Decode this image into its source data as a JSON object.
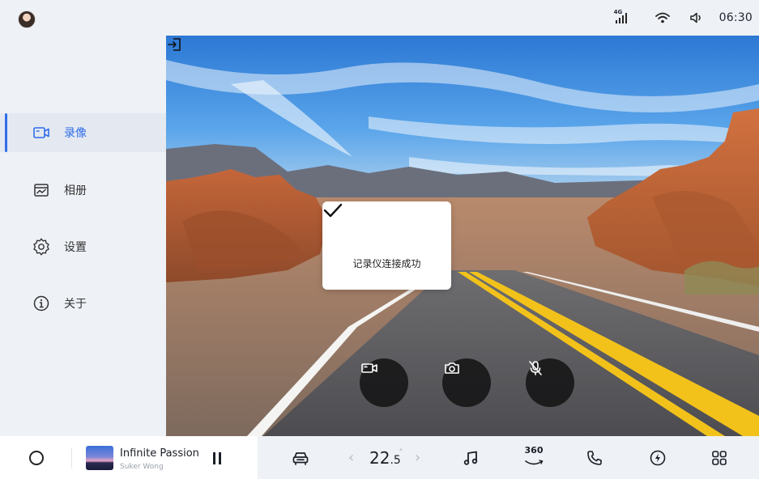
{
  "status_bar": {
    "network_label": "4G",
    "time": "06:30"
  },
  "sidebar": {
    "items": [
      {
        "label": "录像",
        "icon": "video-icon",
        "active": true
      },
      {
        "label": "相册",
        "icon": "album-icon",
        "active": false
      },
      {
        "label": "设置",
        "icon": "gear-icon",
        "active": false
      },
      {
        "label": "关于",
        "icon": "info-icon",
        "active": false
      }
    ]
  },
  "toast": {
    "message": "记录仪连接成功"
  },
  "controls": [
    "record-video-icon",
    "camera-icon",
    "mic-off-icon"
  ],
  "dock": {
    "now_playing": {
      "title": "Infinite Passion",
      "artist": "Suker Wong"
    },
    "temperature": {
      "whole": "22",
      "decimal": ".5",
      "unit": "°"
    },
    "label_360": "360"
  },
  "colors": {
    "accent": "#2f6ee8",
    "background": "#eef1f6",
    "control_bg": "#141416"
  }
}
